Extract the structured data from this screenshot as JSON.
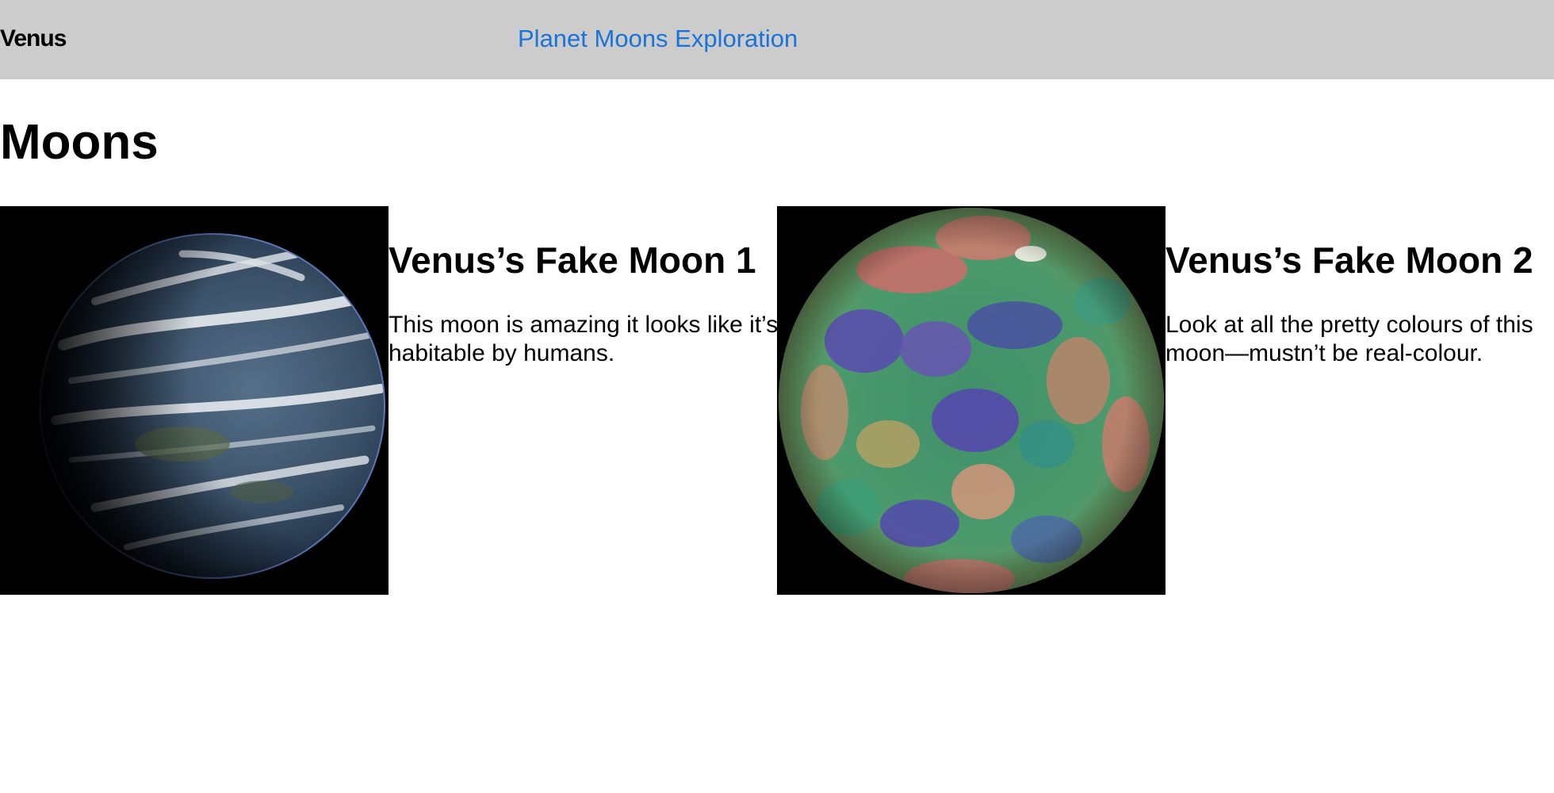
{
  "header": {
    "brand": "Venus",
    "link_label": "Planet Moons Exploration",
    "background_color": "#cccccc",
    "link_color": "#1a73d8"
  },
  "main": {
    "title": "Moons",
    "moons": [
      {
        "title": "Venus’s Fake Moon 1",
        "description": "This moon is amazing it looks like it’s habitable by humans.",
        "image": "earth-like-planet-photo"
      },
      {
        "title": "Venus’s Fake Moon 2",
        "description": "Look at all the pretty colours of this moon—mustn’t be real-colour.",
        "image": "false-color-venus-topography-photo"
      }
    ]
  }
}
